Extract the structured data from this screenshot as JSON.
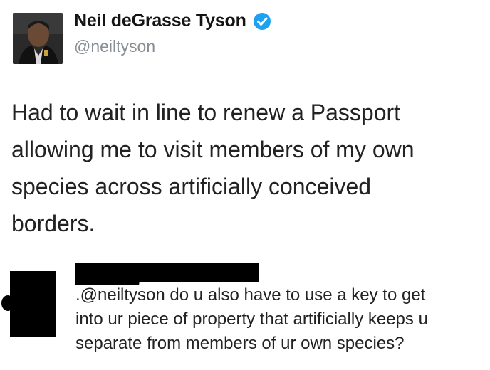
{
  "tweet": {
    "author_name": "Neil deGrasse Tyson",
    "author_handle": "@neiltyson",
    "verified_icon": "verified-badge-icon",
    "text_lines": [
      "Had to wait in line to renew a Passport",
      "allowing me to visit members of my own",
      "species across artificially conceived",
      "borders."
    ]
  },
  "reply": {
    "text_lines": [
      ".@neiltyson do u also have to use a key to get",
      "into ur piece of property that artificially keeps u",
      "separate from members of ur own species?"
    ]
  },
  "colors": {
    "verified_blue": "#1da1f2",
    "handle_gray": "#8a8f94",
    "redaction": "#000000"
  }
}
